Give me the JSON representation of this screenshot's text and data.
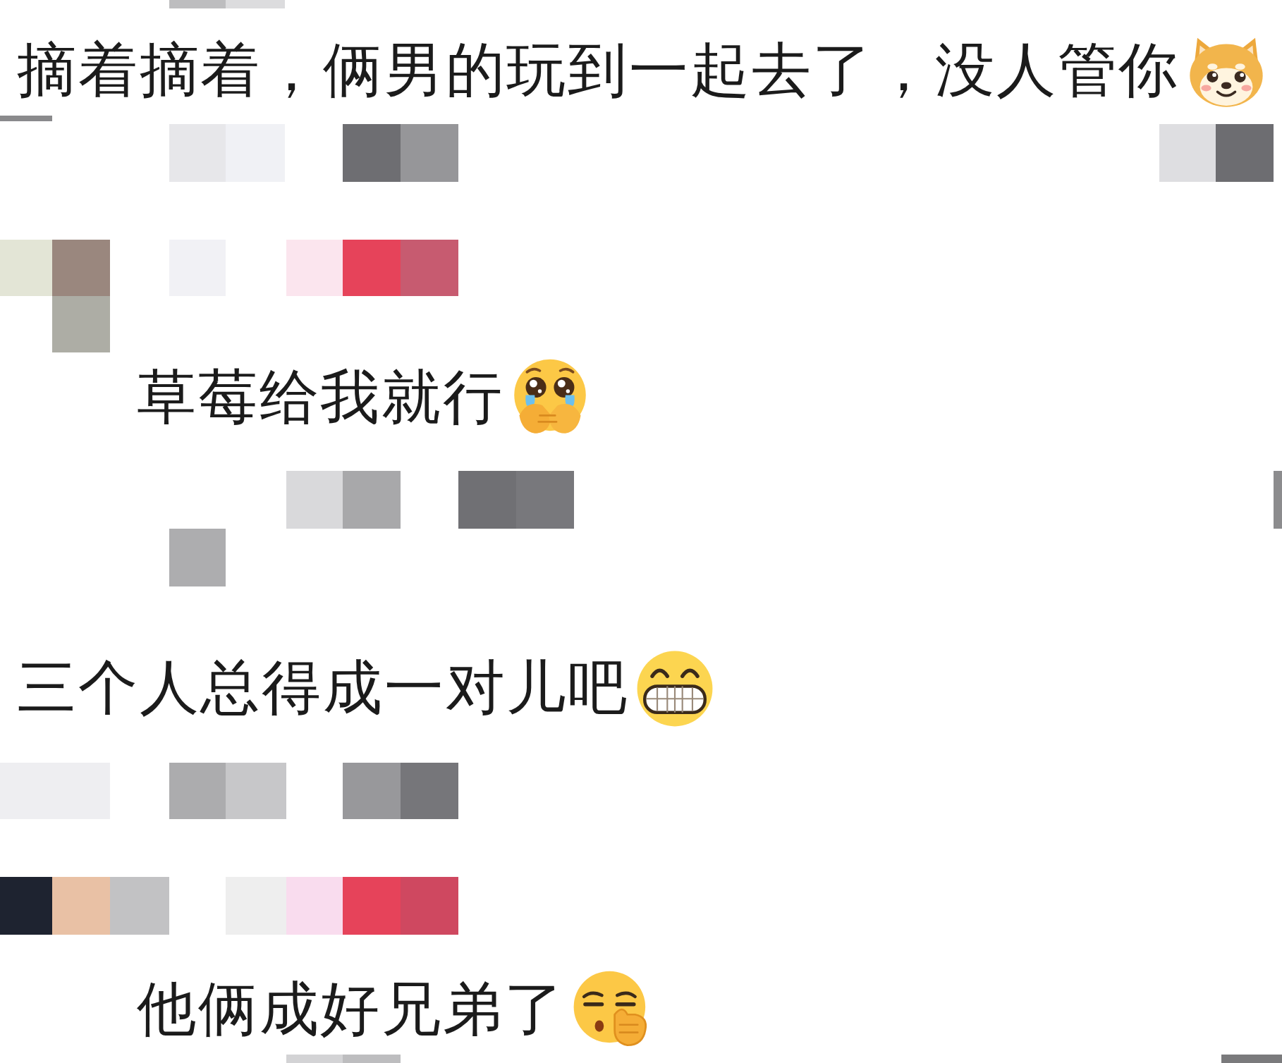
{
  "comments": [
    {
      "kind": "top",
      "text": "摘着摘着，俩男的玩到一起去了，没人管你"
    },
    {
      "kind": "reply",
      "text": "草莓给我就行"
    },
    {
      "kind": "top",
      "text": "三个人总得成一对儿吧"
    },
    {
      "kind": "reply",
      "text": "他俩成好兄弟了"
    }
  ]
}
